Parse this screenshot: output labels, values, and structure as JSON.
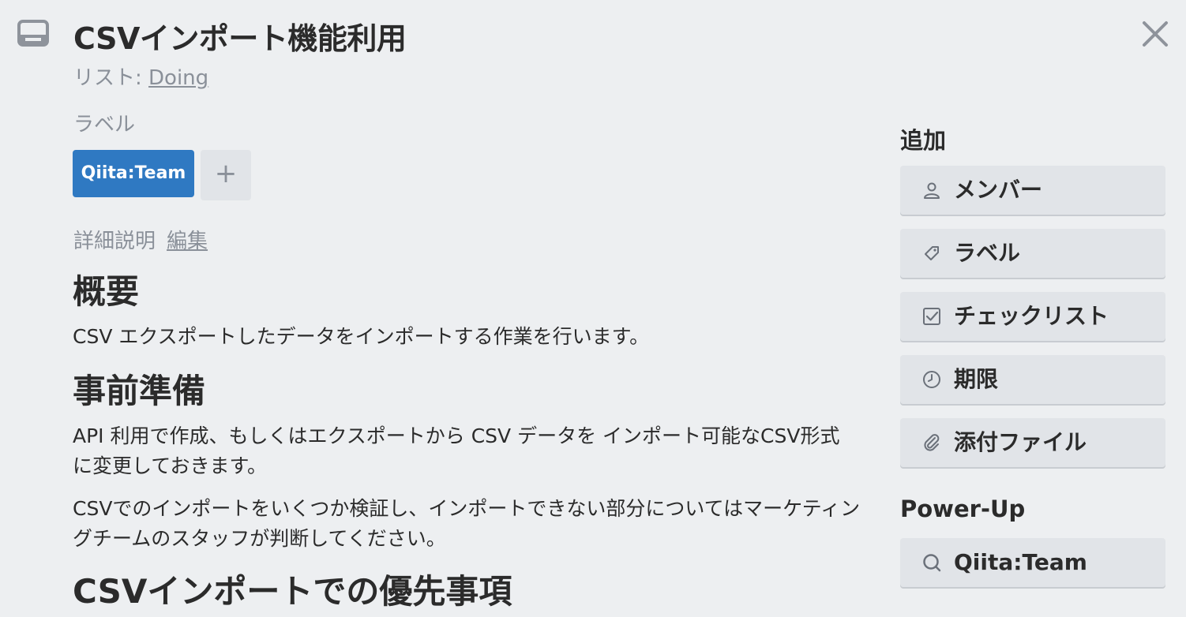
{
  "card": {
    "title": "CSVインポート機能利用",
    "list_prefix": "リスト: ",
    "list_name": "Doing"
  },
  "labels": {
    "heading": "ラベル",
    "items": [
      {
        "text": "Qiita:Team",
        "color": "#2f79c2"
      }
    ],
    "add_button": "+"
  },
  "description": {
    "heading": "詳細説明",
    "edit_link": "編集",
    "blocks": {
      "h1_overview": "概要",
      "p_overview": "CSV エクスポートしたデータをインポートする作業を行います。",
      "h1_prep": "事前準備",
      "p_prep_1": "API 利用で作成、もしくはエクスポートから CSV データを インポート可能なCSV形式に変更しておきます。",
      "p_prep_2": "CSVでのインポートをいくつか検証し、インポートできない部分についてはマーケティングチームのスタッフが判断してください。",
      "h1_priority": "CSVインポートでの優先事項"
    }
  },
  "sidebar": {
    "add_heading": "追加",
    "add_buttons": [
      {
        "label": "メンバー",
        "icon": "person-icon"
      },
      {
        "label": "ラベル",
        "icon": "tag-icon"
      },
      {
        "label": "チェックリスト",
        "icon": "checkbox-icon"
      },
      {
        "label": "期限",
        "icon": "clock-icon"
      },
      {
        "label": "添付ファイル",
        "icon": "paperclip-icon"
      }
    ],
    "powerup_heading": "Power-Up",
    "powerup_buttons": [
      {
        "label": "Qiita:Team",
        "icon": "search-icon"
      }
    ]
  },
  "colors": {
    "background": "#edeff1",
    "label_blue": "#2f79c2",
    "muted_text": "#8a9099",
    "button_bg": "#e1e4e8"
  }
}
